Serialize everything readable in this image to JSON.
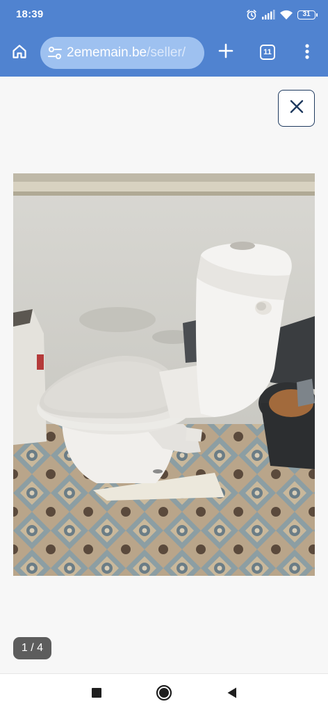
{
  "status_bar": {
    "time": "18:39",
    "battery": "31",
    "icons": [
      "alarm-icon",
      "cell-signal-icon",
      "wifi-icon",
      "battery-icon"
    ]
  },
  "browser": {
    "url_host": "2ememain.be",
    "url_path": "/seller/",
    "tab_count": "11",
    "icons": [
      "home-icon",
      "site-settings-icon",
      "new-tab-icon",
      "tab-switcher-icon",
      "more-vert-icon"
    ],
    "colors": {
      "toolbar": "#5083d0",
      "url_pill": "#9ec1f0"
    }
  },
  "viewer": {
    "close_icon": "close-icon",
    "photo_subject": "white toilet with seat and cistern on a patterned tile floor",
    "counter": "1 / 4"
  },
  "nav_bar": {
    "icons": [
      "recents-square-icon",
      "home-circle-icon",
      "back-triangle-icon"
    ]
  }
}
